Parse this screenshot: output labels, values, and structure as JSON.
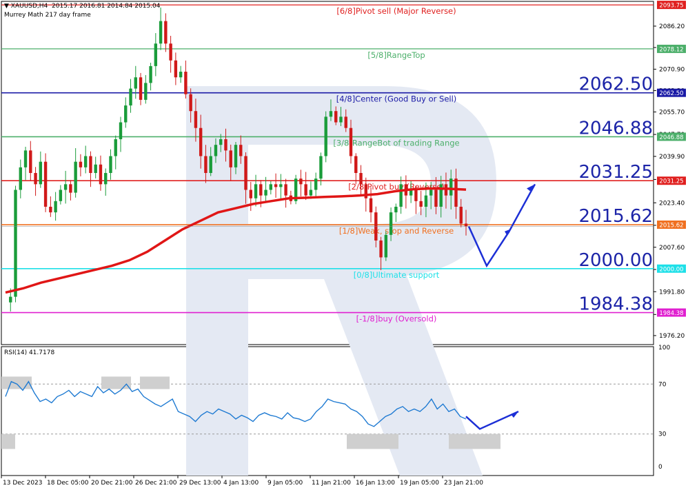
{
  "header": {
    "symbol": "XAUUSD,H4",
    "ohlc": "2015.17 2016.81 2014.84 2015.04",
    "indicator": "Murrey Math 217 day frame",
    "rsi_label": "RSI(14) 41.7178"
  },
  "chart_data": [
    {
      "type": "candlestick",
      "symbol": "XAUUSD",
      "timeframe": "H4",
      "price_range": [
        1973,
        2095
      ],
      "y_ticks": [
        2086.2,
        2078.6,
        2070.9,
        2063.3,
        2055.7,
        2047.7,
        2039.9,
        2031.7,
        2023.4,
        2015.4,
        2007.6,
        1999.7,
        1991.8,
        1983.7,
        1976.2
      ],
      "y_tick_labels": [
        "2086.20",
        "2078.60",
        "2070.90",
        "2063.30",
        "2055.70",
        "2047.70",
        "2039.90",
        "2031.70",
        "2023.40",
        "2015.40",
        "2007.60",
        "1999.70",
        "1991.80",
        "1983.70",
        "1976.20"
      ],
      "x_labels": [
        "13 Dec 2023",
        "18 Dec 05:00",
        "20 Dec 21:00",
        "26 Dec 21:00",
        "29 Dec 13:00",
        "4 Jan 13:00",
        "9 Jan 05:00",
        "11 Jan 21:00",
        "16 Jan 13:00",
        "19 Jan 05:00",
        "23 Jan 21:00"
      ],
      "close_path": [
        1988,
        1990,
        2028,
        2036,
        2042,
        2034,
        2030,
        2038,
        2022,
        2020,
        2024,
        2028,
        2030,
        2027,
        2038,
        2036,
        2040,
        2034,
        2037,
        2030,
        2034,
        2040,
        2046,
        2052,
        2058,
        2064,
        2068,
        2060,
        2066,
        2072,
        2080,
        2088,
        2080,
        2074,
        2068,
        2070,
        2062,
        2056,
        2050,
        2040,
        2034,
        2040,
        2044,
        2046,
        2042,
        2036,
        2044,
        2040,
        2028,
        2025,
        2030,
        2026,
        2028,
        2030,
        2029,
        2030,
        2026,
        2024,
        2032,
        2030,
        2026,
        2028,
        2032,
        2040,
        2054,
        2056,
        2052,
        2054,
        2050,
        2040,
        2034,
        2030,
        2025,
        2020,
        2010,
        2004,
        2012,
        2020,
        2022,
        2030,
        2026,
        2028,
        2024,
        2022,
        2026,
        2028,
        2022,
        2030,
        2026,
        2032,
        2022,
        2016,
        2015
      ],
      "ma_path": [
        1991.5,
        1993,
        1995,
        1996.5,
        1998,
        1999.5,
        2001,
        2003,
        2006,
        2010,
        2014,
        2017,
        2020,
        2021.5,
        2023,
        2024,
        2025,
        2025.2,
        2025.5,
        2025.7,
        2026,
        2026.5,
        2027.5,
        2028.2,
        2028.5,
        2028.4,
        2028.1
      ],
      "murrey_levels": [
        {
          "label": "[6/8]Pivot sell (Major Reverse)",
          "value": 2093.75,
          "tag": "2093.75",
          "color": "#e0201f"
        },
        {
          "label": "[5/8]RangeTop",
          "value": 2078.12,
          "tag": "2078.12",
          "color": "#4caf6a"
        },
        {
          "label": "[4/8]Center (Good Buy or Sell)",
          "value": 2062.5,
          "tag": "2062.50",
          "big": "2062.50",
          "color": "#1a1aa6"
        },
        {
          "label": "[3/8]RangeBot of trading Range",
          "value": 2046.88,
          "tag": "2046.88",
          "big": "2046.88",
          "color": "#4caf6a"
        },
        {
          "label": "[2/8]Pivot buy (Reverse)",
          "value": 2031.25,
          "tag": "2031.25",
          "big": "2031.25",
          "color": "#e0201f"
        },
        {
          "label": "[1/8]Weak, stop and Reverse",
          "value": 2015.62,
          "tag": "2015.62",
          "big": "2015.62",
          "color": "#f07020"
        },
        {
          "label": "[0/8]Ultimate support",
          "value": 2000.0,
          "tag": "2000.00",
          "big": "2000.00",
          "color": "#1ee0e8"
        },
        {
          "label": "[-1/8]buy (Oversold)",
          "value": 1984.38,
          "tag": "1984.38",
          "big": "1984.38",
          "color": "#e020d0"
        }
      ],
      "current_price": 2015.04,
      "forecast": [
        2015,
        2001,
        2013,
        2030
      ]
    },
    {
      "type": "line",
      "name": "RSI(14)",
      "value": 41.7178,
      "ylim": [
        0,
        100
      ],
      "levels": [
        30,
        70
      ],
      "y_ticks": [
        "100",
        "70",
        "30",
        "0"
      ],
      "rsi_path": [
        60,
        72,
        70,
        65,
        72,
        63,
        56,
        58,
        55,
        60,
        62,
        65,
        60,
        64,
        62,
        60,
        68,
        63,
        66,
        62,
        65,
        70,
        64,
        66,
        60,
        57,
        54,
        52,
        55,
        58,
        48,
        46,
        44,
        40,
        45,
        48,
        46,
        50,
        48,
        46,
        42,
        45,
        43,
        40,
        45,
        47,
        45,
        44,
        42,
        47,
        43,
        42,
        40,
        42,
        48,
        52,
        58,
        56,
        55,
        54,
        50,
        48,
        44,
        38,
        36,
        40,
        44,
        46,
        50,
        52,
        48,
        50,
        48,
        52,
        58,
        50,
        54,
        48,
        50,
        44,
        42
      ],
      "forecast": [
        44,
        34,
        48
      ],
      "shaded_zones": [
        "overbought",
        "oversold"
      ]
    }
  ],
  "colors": {
    "candle_up": "#1a9c3a",
    "candle_down": "#d01919",
    "ma": "#e01616",
    "rsi": "#1e7ad2",
    "forecast": "#1c2fd6",
    "watermark": "#e4e9f3"
  }
}
